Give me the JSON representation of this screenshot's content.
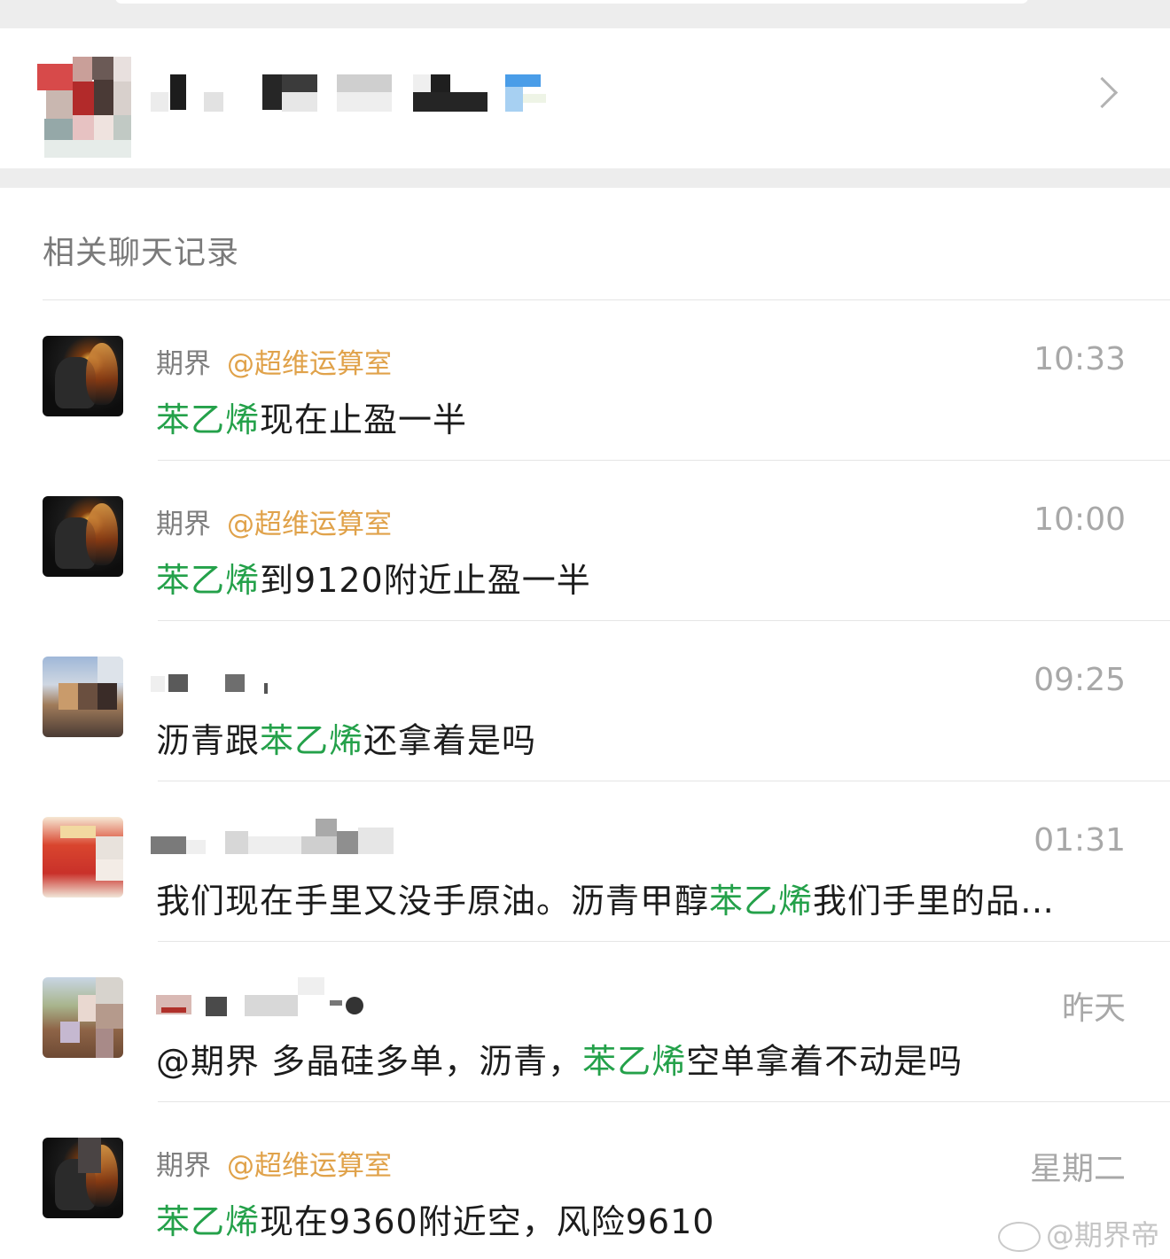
{
  "section_title": "相关聊天记录",
  "results": [
    {
      "sender": "期界",
      "mention": "@超维运算室",
      "time": "10:33",
      "message_highlight": "苯乙烯",
      "message_before": "",
      "message_after": "现在止盈一半",
      "avatar": "poker-flame"
    },
    {
      "sender": "期界",
      "mention": "@超维运算室",
      "time": "10:00",
      "message_highlight": "苯乙烯",
      "message_before": "",
      "message_after": "到9120附近止盈一半",
      "avatar": "poker-flame"
    },
    {
      "sender": "",
      "mention": "",
      "time": "09:25",
      "message_before": "沥青跟",
      "message_highlight": "苯乙烯",
      "message_after": "还拿着是吗",
      "avatar": "sky"
    },
    {
      "sender": "",
      "mention": "",
      "time": "01:31",
      "message_before": "我们现在手里又没手原油。沥青甲醇",
      "message_highlight": "苯乙烯",
      "message_after": "我们手里的品…",
      "avatar": "red-poster"
    },
    {
      "sender": "",
      "mention": "",
      "time": "昨天",
      "message_before": "@期界 多晶硅多单，沥青，",
      "message_highlight": "苯乙烯",
      "message_after": "空单拿着不动是吗",
      "avatar": "field"
    },
    {
      "sender": "期界",
      "mention": "@超维运算室",
      "time": "星期二",
      "message_highlight": "苯乙烯",
      "message_before": "",
      "message_after": "现在9360附近空，风险9610",
      "avatar": "poker-flame"
    }
  ],
  "watermark": "@期界帝",
  "colors": {
    "highlight": "#24a14a",
    "mention": "#e0a24a",
    "time": "#a8a8a8"
  },
  "icons": [
    "chevron-right-icon",
    "weibo-icon"
  ]
}
